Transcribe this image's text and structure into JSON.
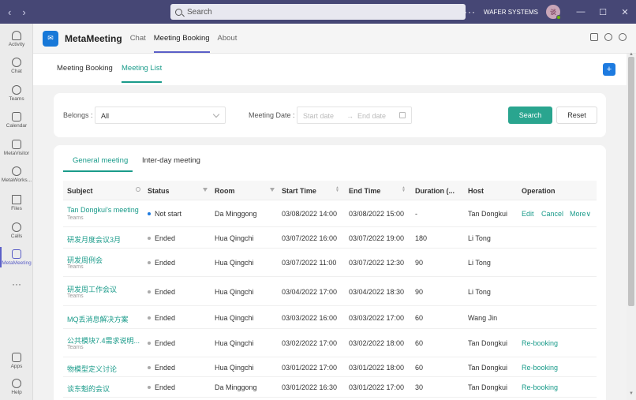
{
  "titlebar": {
    "search_placeholder": "Search",
    "more": "···",
    "org": "WAFER SYSTEMS",
    "avatar_initial": "谈"
  },
  "rail": [
    {
      "label": "Activity"
    },
    {
      "label": "Chat"
    },
    {
      "label": "Teams"
    },
    {
      "label": "Calendar"
    },
    {
      "label": "MetaVisitor"
    },
    {
      "label": "MetaWorks..."
    },
    {
      "label": "Files"
    },
    {
      "label": "Calls"
    },
    {
      "label": "MetaMeeting"
    },
    {
      "label": "···"
    },
    {
      "label": "Apps"
    },
    {
      "label": "Help"
    }
  ],
  "app": {
    "name": "MetaMeeting",
    "tabs": [
      "Chat",
      "Meeting Booking",
      "About"
    ]
  },
  "subtabs": [
    "Meeting Booking",
    "Meeting List"
  ],
  "filters": {
    "belongs_label": "Belongs :",
    "belongs_value": "All",
    "date_label": "Meeting Date :",
    "start_placeholder": "Start date",
    "arrow": "→",
    "end_placeholder": "End date",
    "search_button": "Search",
    "reset_button": "Reset"
  },
  "table_tabs": [
    "General meeting",
    "Inter-day meeting"
  ],
  "columns": {
    "subject": "Subject",
    "status": "Status",
    "room": "Room",
    "start": "Start Time",
    "end": "End Time",
    "duration": "Duration (...",
    "host": "Host",
    "operation": "Operation"
  },
  "rows": [
    {
      "subject": "Tan Dongkui's meeting",
      "teams": "Teams",
      "status": "Not start",
      "room": "Da Minggong",
      "start": "03/08/2022 14:00",
      "end": "03/08/2022 15:00",
      "duration": "-",
      "host": "Tan Dongkui",
      "op1": "Edit",
      "op2": "Cancel",
      "op3": "More∨"
    },
    {
      "subject": "研发月度会议3月",
      "teams": "",
      "status": "Ended",
      "room": "Hua Qingchi",
      "start": "03/07/2022 16:00",
      "end": "03/07/2022 19:00",
      "duration": "180",
      "host": "Li Tong",
      "op1": "",
      "op2": "",
      "op3": ""
    },
    {
      "subject": "研发周例会",
      "teams": "Teams",
      "status": "Ended",
      "room": "Hua Qingchi",
      "start": "03/07/2022 11:00",
      "end": "03/07/2022 12:30",
      "duration": "90",
      "host": "Li Tong",
      "op1": "",
      "op2": "",
      "op3": ""
    },
    {
      "subject": "研发周工作会议",
      "teams": "Teams",
      "status": "Ended",
      "room": "Hua Qingchi",
      "start": "03/04/2022 17:00",
      "end": "03/04/2022 18:30",
      "duration": "90",
      "host": "Li Tong",
      "op1": "",
      "op2": "",
      "op3": ""
    },
    {
      "subject": "MQ丢消息解决方案",
      "teams": "",
      "status": "Ended",
      "room": "Hua Qingchi",
      "start": "03/03/2022 16:00",
      "end": "03/03/2022 17:00",
      "duration": "60",
      "host": "Wang Jin",
      "op1": "",
      "op2": "",
      "op3": ""
    },
    {
      "subject": "公共模块7.4需求说明...",
      "teams": "Teams",
      "status": "Ended",
      "room": "Hua Qingchi",
      "start": "03/02/2022 17:00",
      "end": "03/02/2022 18:00",
      "duration": "60",
      "host": "Tan Dongkui",
      "op1": "Re-booking",
      "op2": "",
      "op3": ""
    },
    {
      "subject": "物模型定义讨论",
      "teams": "",
      "status": "Ended",
      "room": "Hua Qingchi",
      "start": "03/01/2022 17:00",
      "end": "03/01/2022 18:00",
      "duration": "60",
      "host": "Tan Dongkui",
      "op1": "Re-booking",
      "op2": "",
      "op3": ""
    },
    {
      "subject": "谈东魁的会议",
      "teams": "",
      "status": "Ended",
      "room": "Da Minggong",
      "start": "03/01/2022 16:30",
      "end": "03/01/2022 17:00",
      "duration": "30",
      "host": "Tan Dongkui",
      "op1": "Re-booking",
      "op2": "",
      "op3": ""
    }
  ]
}
